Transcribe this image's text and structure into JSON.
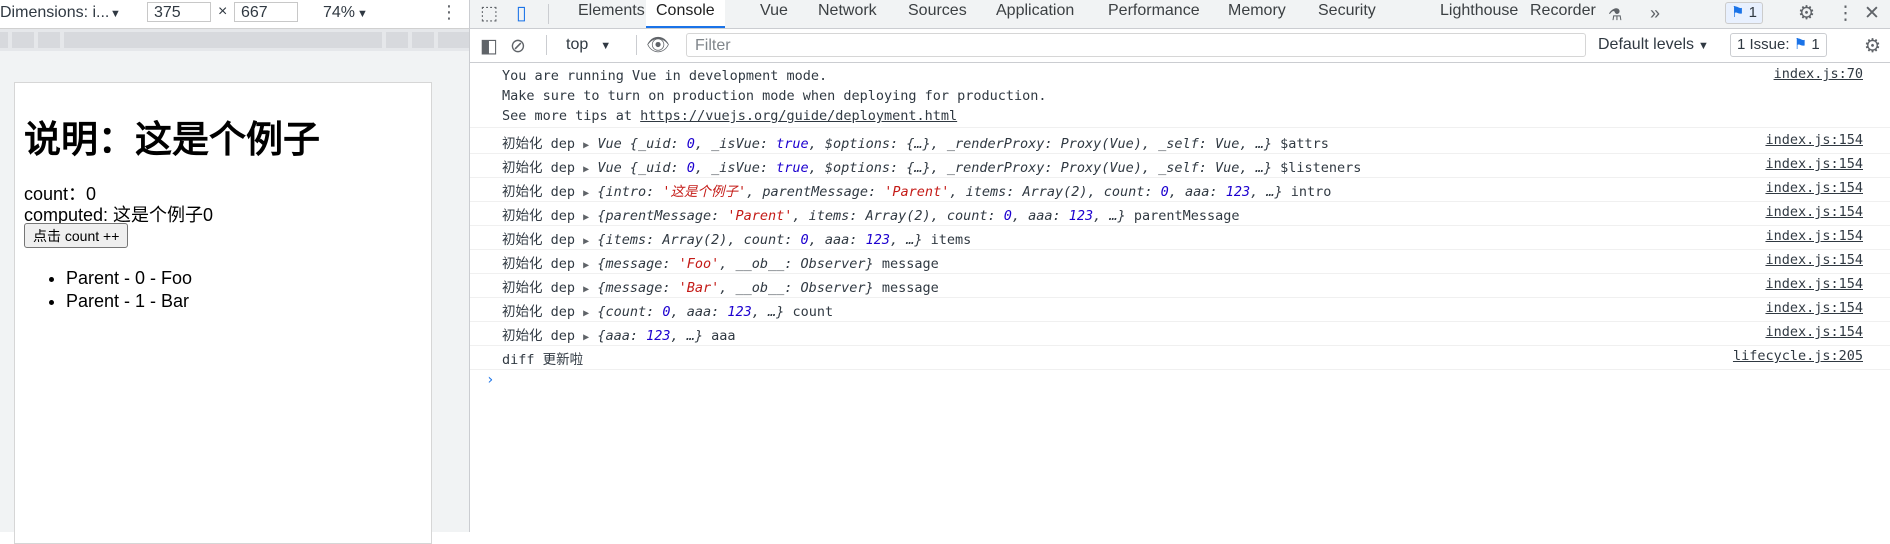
{
  "device_toolbar": {
    "dimensions_label": "Dimensions: i...",
    "width": "375",
    "times": "×",
    "height": "667",
    "zoom": "74%"
  },
  "device_page": {
    "title": "说明：这是个例子",
    "count_line": "count：0",
    "computed_line": "computed: 这是个例子0",
    "button_label": "点击 count ++",
    "list": [
      "Parent - 0 - Foo",
      "Parent - 1 - Bar"
    ]
  },
  "tabs": [
    "Elements",
    "Console",
    "Vue",
    "Network",
    "Sources",
    "Application",
    "Performance",
    "Memory",
    "Security",
    "Lighthouse",
    "Recorder"
  ],
  "active_tab": "Console",
  "tab_issues_count": "1",
  "console_toolbar": {
    "context": "top",
    "filter_placeholder": "Filter",
    "levels": "Default levels",
    "issues_label": "1 Issue:",
    "issues_count": "1"
  },
  "console": {
    "vue_msg_line1": "You are running Vue in development mode.",
    "vue_msg_line2": "Make sure to turn on production mode when deploying for production.",
    "vue_msg_line3_prefix": "See more tips at ",
    "vue_msg_link": "https://vuejs.org/guide/deployment.html",
    "vue_msg_source": "index.js:70",
    "prefix": "初始化 dep",
    "rows": [
      {
        "object": "Vue {_uid: 0, _isVue: true, $options: {…}, _renderProxy: Proxy(Vue), _self: Vue, …}",
        "suffix": "$attrs",
        "source": "index.js:154"
      },
      {
        "object": "Vue {_uid: 0, _isVue: true, $options: {…}, _renderProxy: Proxy(Vue), _self: Vue, …}",
        "suffix": "$listeners",
        "source": "index.js:154"
      },
      {
        "object": "{intro: '这是个例子', parentMessage: 'Parent', items: Array(2), count: 0, aaa: 123, …}",
        "suffix": "intro",
        "source": "index.js:154"
      },
      {
        "object": "{parentMessage: 'Parent', items: Array(2), count: 0, aaa: 123, …}",
        "suffix": "parentMessage",
        "source": "index.js:154"
      },
      {
        "object": "{items: Array(2), count: 0, aaa: 123, …}",
        "suffix": "items",
        "source": "index.js:154"
      },
      {
        "object": "{message: 'Foo', __ob__: Observer}",
        "suffix": "message",
        "source": "index.js:154"
      },
      {
        "object": "{message: 'Bar', __ob__: Observer}",
        "suffix": "message",
        "source": "index.js:154"
      },
      {
        "object": "{count: 0, aaa: 123, …}",
        "suffix": "count",
        "source": "index.js:154"
      },
      {
        "object": "{aaa: 123, …}",
        "suffix": "aaa",
        "source": "index.js:154"
      }
    ],
    "diff_msg": "diff 更新啦",
    "diff_source": "lifecycle.js:205"
  }
}
